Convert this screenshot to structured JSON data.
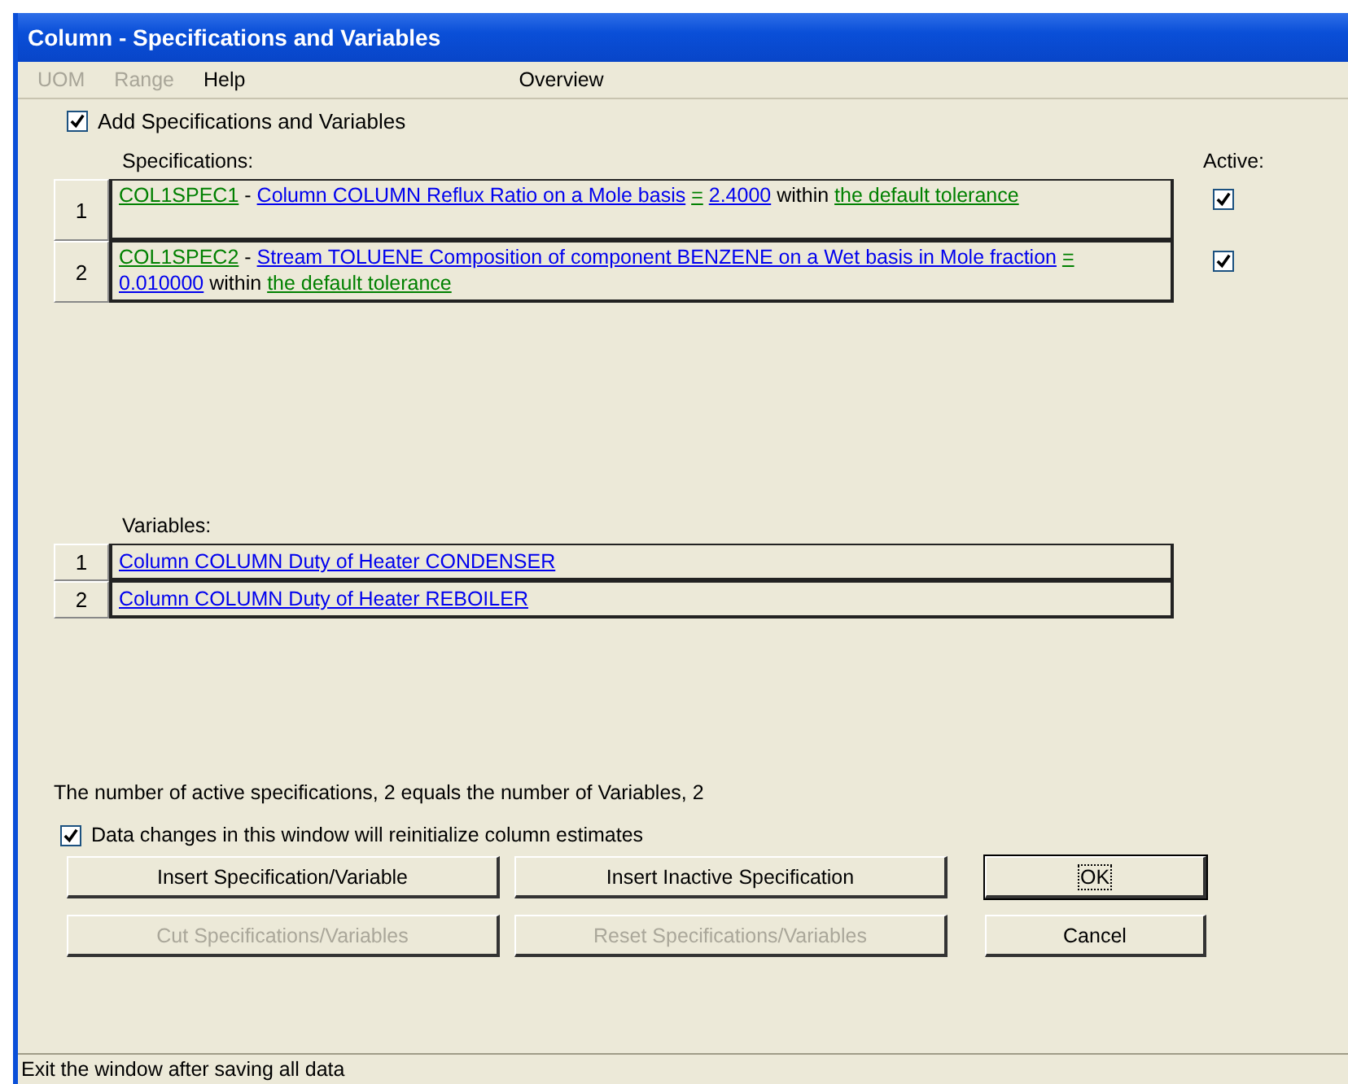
{
  "window": {
    "title": "Column - Specifications and Variables"
  },
  "menu": [
    {
      "label": "UOM",
      "disabled": true
    },
    {
      "label": "Range",
      "disabled": true
    },
    {
      "label": "Help",
      "disabled": false
    },
    {
      "label": "Overview",
      "disabled": false
    }
  ],
  "add_checkbox": {
    "label": "Add Specifications and Variables",
    "checked": true
  },
  "specifications": {
    "heading": "Specifications:",
    "active_heading": "Active:",
    "rows": [
      {
        "number": "1",
        "active": true,
        "segments": [
          {
            "kind": "tag",
            "text": "COL1SPEC1"
          },
          {
            "kind": "plain",
            "text": "-"
          },
          {
            "kind": "link",
            "text": "Column COLUMN Reflux Ratio on a Mole basis"
          },
          {
            "kind": "tag",
            "text": "="
          },
          {
            "kind": "link",
            "text": "2.4000"
          },
          {
            "kind": "plain",
            "text": "within"
          },
          {
            "kind": "tag",
            "text": "the default tolerance"
          }
        ]
      },
      {
        "number": "2",
        "active": true,
        "segments": [
          {
            "kind": "tag",
            "text": "COL1SPEC2"
          },
          {
            "kind": "plain",
            "text": "-"
          },
          {
            "kind": "link",
            "text": "Stream TOLUENE Composition of component BENZENE on a Wet basis in Mole fraction"
          },
          {
            "kind": "tag",
            "text": "="
          },
          {
            "kind": "link",
            "text": "0.010000"
          },
          {
            "kind": "plain",
            "text": "within"
          },
          {
            "kind": "tag",
            "text": "the default tolerance"
          }
        ]
      }
    ]
  },
  "variables": {
    "heading": "Variables:",
    "rows": [
      {
        "number": "1",
        "text": "Column COLUMN Duty of Heater CONDENSER"
      },
      {
        "number": "2",
        "text": "Column COLUMN Duty of Heater REBOILER"
      }
    ]
  },
  "message": "The number of active specifications, 2 equals the number of Variables, 2",
  "reinit_checkbox": {
    "label": "Data changes in this window will reinitialize column estimates",
    "checked": true
  },
  "buttons": [
    {
      "label": "Insert Specification/Variable",
      "disabled": false,
      "focused": false
    },
    {
      "label": "Insert Inactive Specification",
      "disabled": false,
      "focused": false
    },
    {
      "label": "OK",
      "disabled": false,
      "focused": true
    },
    {
      "label": "Cut Specifications/Variables",
      "disabled": true,
      "focused": false
    },
    {
      "label": "Reset Specifications/Variables",
      "disabled": true,
      "focused": false
    },
    {
      "label": "Cancel",
      "disabled": false,
      "focused": false
    }
  ],
  "status_bar": "Exit the window after saving all data"
}
